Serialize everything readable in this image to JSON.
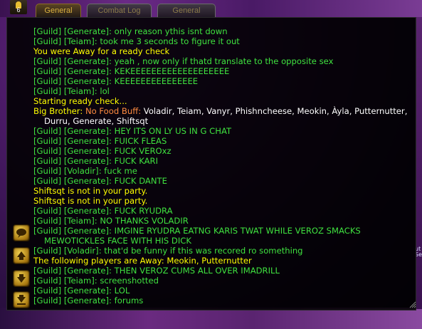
{
  "badge": {
    "count": "6"
  },
  "tabs": [
    {
      "label": "General",
      "active": true
    },
    {
      "label": "Combat Log",
      "active": false
    },
    {
      "label": "General",
      "active": false
    }
  ],
  "colors": {
    "guild": "#3fe23f",
    "system": "#ffff00",
    "white": "#ffffff",
    "buff": "#ff8c40"
  },
  "right_edge_text": [
    "ut",
    "Se"
  ],
  "chat": {
    "lines": [
      {
        "type": "guild",
        "text": "[Guild] [Generate]: only reason ythis isnt down"
      },
      {
        "type": "guild",
        "text": "[Guild] [Teiam]: took me 3 seconds to figure it out"
      },
      {
        "type": "system",
        "text": "You were Away for a ready check"
      },
      {
        "type": "guild",
        "text": "[Guild] [Generate]: yeah , now only if thatd translate to the opposite sex"
      },
      {
        "type": "guild",
        "text": "[Guild] [Generate]: KEKEEEEEEEEEEEEEEEEEEE"
      },
      {
        "type": "guild",
        "text": "[Guild] [Generate]: KEEEEEEEEEEEEEEE"
      },
      {
        "type": "guild",
        "text": "[Guild] [Teiam]: lol"
      },
      {
        "type": "system",
        "text": "Starting ready check..."
      },
      {
        "type": "buff",
        "prefix": "Big Brother: ",
        "label": "No Food Buff: ",
        "text": "Voladir, Teiam, Vanyr, Phishncheese, Meokin, Àyla, Putternutter, Durru, Generate, Shiftsqt"
      },
      {
        "type": "guild",
        "text": "[Guild] [Generate]: HEY ITS ON LY US IN G CHAT"
      },
      {
        "type": "guild",
        "text": "[Guild] [Generate]: FUICK FLEAS"
      },
      {
        "type": "guild",
        "text": "[Guild] [Generate]: FUCK VEROxz"
      },
      {
        "type": "guild",
        "text": "[Guild] [Generate]: FUCK KARI"
      },
      {
        "type": "guild",
        "text": "[Guild] [Voladir]: fuck me"
      },
      {
        "type": "guild",
        "text": "[Guild] [Generate]: FUCK DANTE"
      },
      {
        "type": "system",
        "text": "Shiftsqt is not in your party."
      },
      {
        "type": "system",
        "text": "Shiftsqt is not in your party."
      },
      {
        "type": "guild",
        "text": "[Guild] [Generate]: FUCK RYUDRA"
      },
      {
        "type": "guild",
        "text": "[Guild] [Teiam]: NO THANKS VOLADIR"
      },
      {
        "type": "guild",
        "text": "[Guild] [Generate]: IMGINE RYUDRA EATNG KARIS TWAT WHILE VEROZ SMACKS MEWOTICKLES FACE WITH HIS DICK"
      },
      {
        "type": "guild",
        "text": "[Guild] [Voladir]: that'd be funny if this was recored ro something"
      },
      {
        "type": "system",
        "text": "The following players are Away: Meokin, Putternutter"
      },
      {
        "type": "guild",
        "text": "[Guild] [Generate]: THEN VEROZ CUMS ALL OVER IMADRILL"
      },
      {
        "type": "guild",
        "text": "[Guild] [Teiam]: screenshotted"
      },
      {
        "type": "guild",
        "text": "[Guild] [Generate]: LOL"
      },
      {
        "type": "guild",
        "text": "[Guild] [Generate]: forums"
      }
    ]
  },
  "buttons": [
    {
      "name": "chat-bubble-button",
      "icon": "chat-bubble-icon"
    },
    {
      "name": "scroll-up-button",
      "icon": "arrow-up-icon"
    },
    {
      "name": "scroll-down-button",
      "icon": "arrow-down-icon"
    },
    {
      "name": "scroll-bottom-button",
      "icon": "arrow-bottom-icon"
    }
  ]
}
